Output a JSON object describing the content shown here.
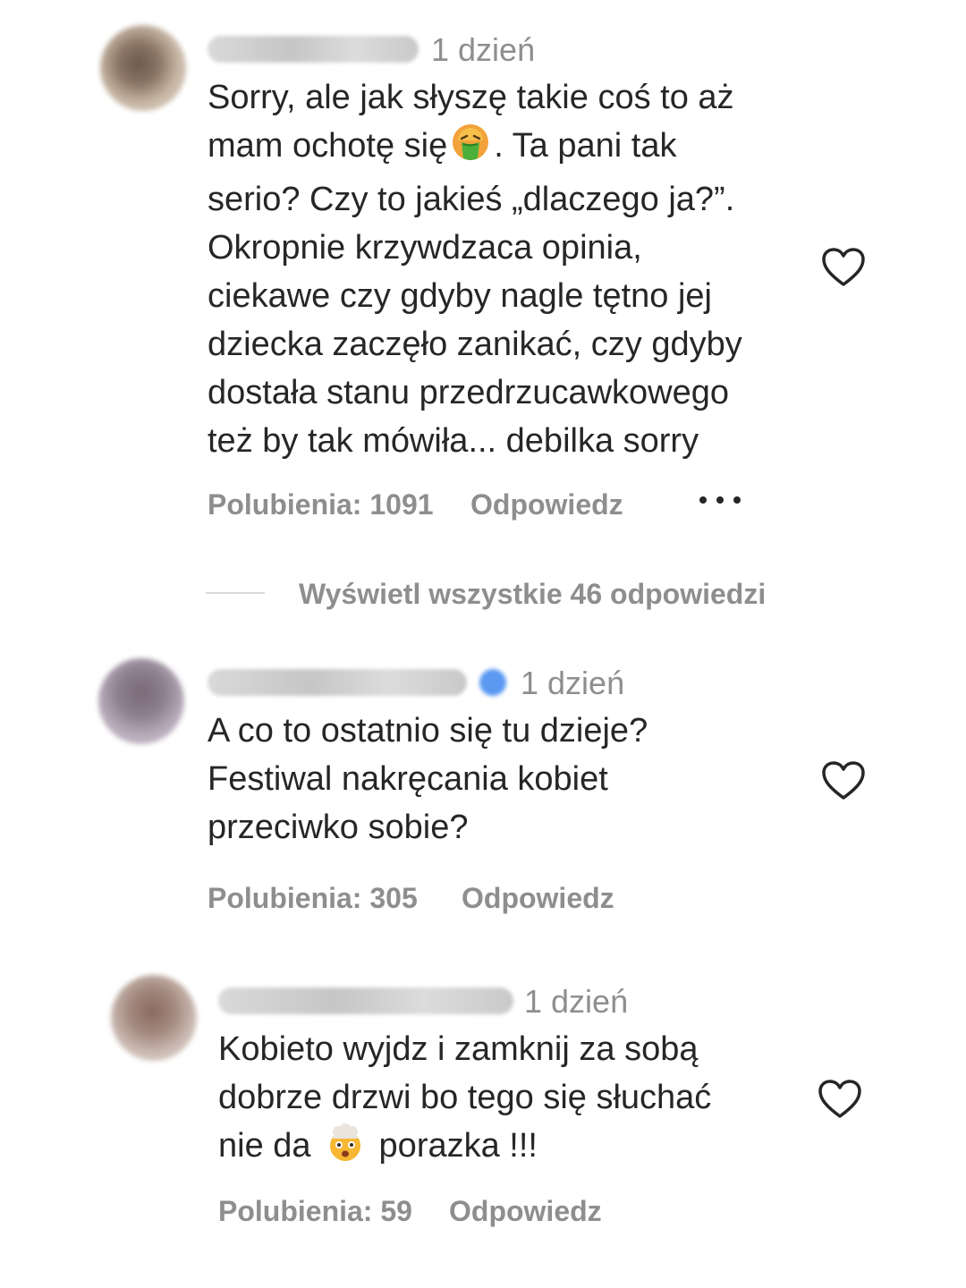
{
  "comments": [
    {
      "time": "1 dzień",
      "lines": [
        "Sorry, ale jak słyszę takie coś to aż",
        "mam ochotę się",
        ". Ta pani tak",
        "serio? Czy to jakieś „dlaczego ja?”.",
        "Okropnie krzywdzaca opinia,",
        "ciekawe czy gdyby nagle tętno jej",
        "dziecka zaczęło zanikać, czy gdyby",
        "dostała stanu przedrzucawkowego",
        "też by tak mówiła... debilka sorry"
      ],
      "emoji": "vomiting-face-icon",
      "likes": "Polubienia: 1091",
      "reply": "Odpowiedz"
    },
    {
      "time": "1 dzień",
      "verified": true,
      "lines": [
        "A co to ostatnio się tu dzieje?",
        "Festiwal nakręcania kobiet",
        "przeciwko sobie?"
      ],
      "likes": "Polubienia: 305",
      "reply": "Odpowiedz"
    },
    {
      "time": "1 dzień",
      "lines": [
        "Kobieto wyjdz i zamknij za sobą",
        "dobrze drzwi bo tego się słuchać",
        "nie da",
        "porazka !!!"
      ],
      "emoji": "exploding-head-icon",
      "likes": "Polubienia: 59",
      "reply": "Odpowiedz"
    }
  ],
  "view_replies": "Wyświetl wszystkie 46 odpowiedzi",
  "colors": {
    "text": "#262626",
    "secondary": "#8e8e8e",
    "divider": "#dbdbdb",
    "verified": "#5a98f2"
  }
}
